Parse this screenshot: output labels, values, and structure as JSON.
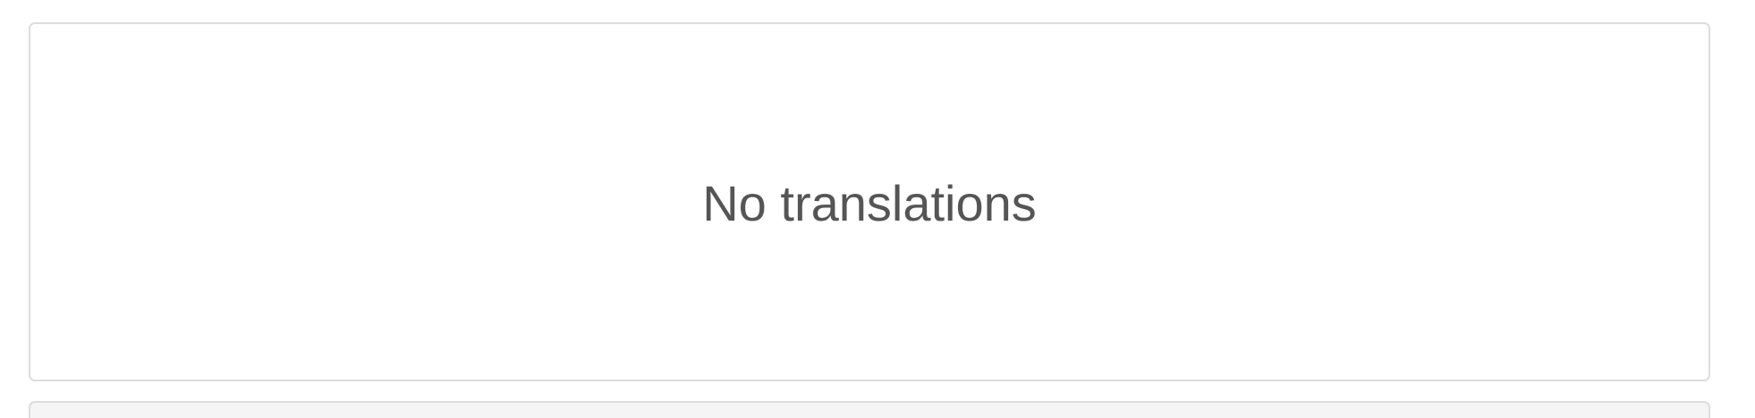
{
  "translations_panel": {
    "empty_message": "No translations"
  }
}
